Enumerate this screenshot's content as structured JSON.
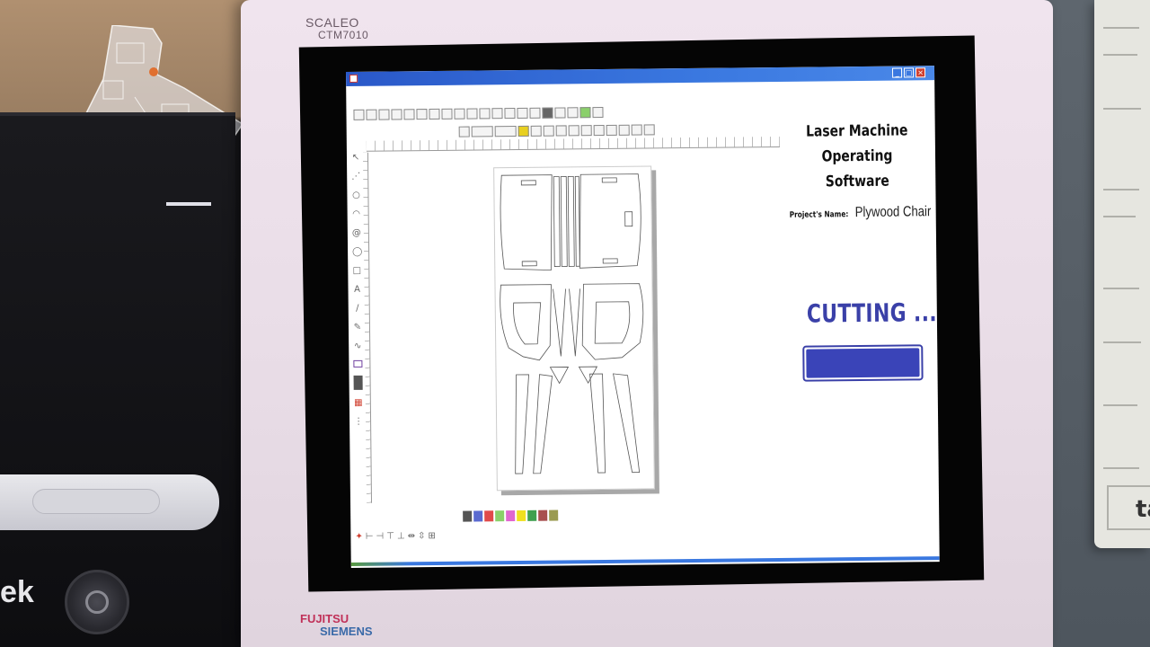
{
  "monitor": {
    "brand": "SCALEO",
    "model": "CTM7010",
    "maker": "FUJITSU",
    "maker_sub": "SIEMENS"
  },
  "pc": {
    "brand": "ek"
  },
  "note_text": "ta",
  "app": {
    "window_buttons": {
      "minimize": "_",
      "maximize": "□",
      "close": "×"
    },
    "toolbar_row1_icons": [
      "new-icon",
      "open-icon",
      "save-icon",
      "print-icon",
      "import-icon",
      "export-icon",
      "cut-icon",
      "copy-icon",
      "paste-icon",
      "undo-icon",
      "redo-icon",
      "hand-icon",
      "zoom-fit-icon",
      "zoom-in-icon",
      "zoom-out-icon",
      "delete-icon",
      "grid-icon",
      "table-icon",
      "layer-icon",
      "settings-icon"
    ],
    "toolbar_row2_icons": [
      "align-icon",
      "width-field",
      "height-field",
      "lock-icon",
      "mirror-icon",
      "rotate-icon",
      "array-icon",
      "group-icon",
      "ungroup-icon",
      "node-icon",
      "weld-icon",
      "trim-icon",
      "offset-icon",
      "refresh-icon"
    ],
    "left_tool_icons": [
      "select-icon",
      "node-edit-icon",
      "circle-icon",
      "arc-icon",
      "spiral-icon",
      "ellipse-icon",
      "rectangle-icon",
      "text-icon",
      "line-icon",
      "pen-icon",
      "curve-icon",
      "image-icon",
      "fill-icon",
      "grid-tool-icon",
      "dots-icon"
    ],
    "text_tool_glyph": "A",
    "palette_colors": [
      "#555555",
      "#5a6ad0",
      "#e04a4a",
      "#8ad06a",
      "#e066d0",
      "#f0e020",
      "#40a050",
      "#a85050",
      "#9a9a50"
    ],
    "bottom_tool_icons": [
      "origin-icon",
      "align-left-icon",
      "align-right-icon",
      "align-top-icon",
      "align-bottom-icon",
      "distribute-h-icon",
      "distribute-v-icon",
      "center-icon"
    ]
  },
  "panel": {
    "title_line1": "Laser Machine",
    "title_line2": "Operating Software",
    "project_label": "Project's Name:",
    "project_name": "Plywood Chair",
    "status": "CUTTING ...",
    "progress_fraction": 1.0,
    "accent_color": "#3a44b8"
  }
}
